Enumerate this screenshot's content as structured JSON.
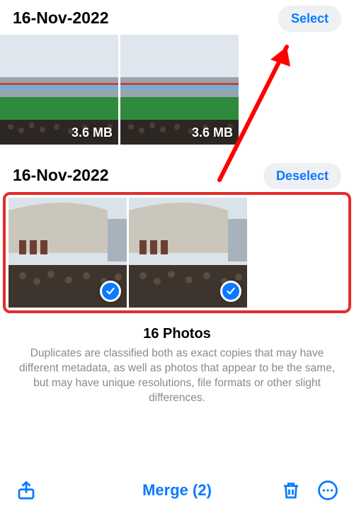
{
  "groups": [
    {
      "date": "16-Nov-2022",
      "action_label": "Select",
      "photos": [
        {
          "size": "3.6 MB",
          "selected": false
        },
        {
          "size": "3.6 MB",
          "selected": false
        }
      ],
      "highlighted": false
    },
    {
      "date": "16-Nov-2022",
      "action_label": "Deselect",
      "photos": [
        {
          "size": "",
          "selected": true
        },
        {
          "size": "",
          "selected": true
        }
      ],
      "highlighted": true
    }
  ],
  "summary": {
    "count_label": "16 Photos",
    "description": "Duplicates are classified both as exact copies that may have different metadata, as well as photos that appear to be the same, but may have unique resolutions, file formats or other slight differences."
  },
  "toolbar": {
    "merge_label": "Merge (2)"
  },
  "colors": {
    "ios_blue": "#0a7aff",
    "annotation_red": "#ff0000"
  }
}
